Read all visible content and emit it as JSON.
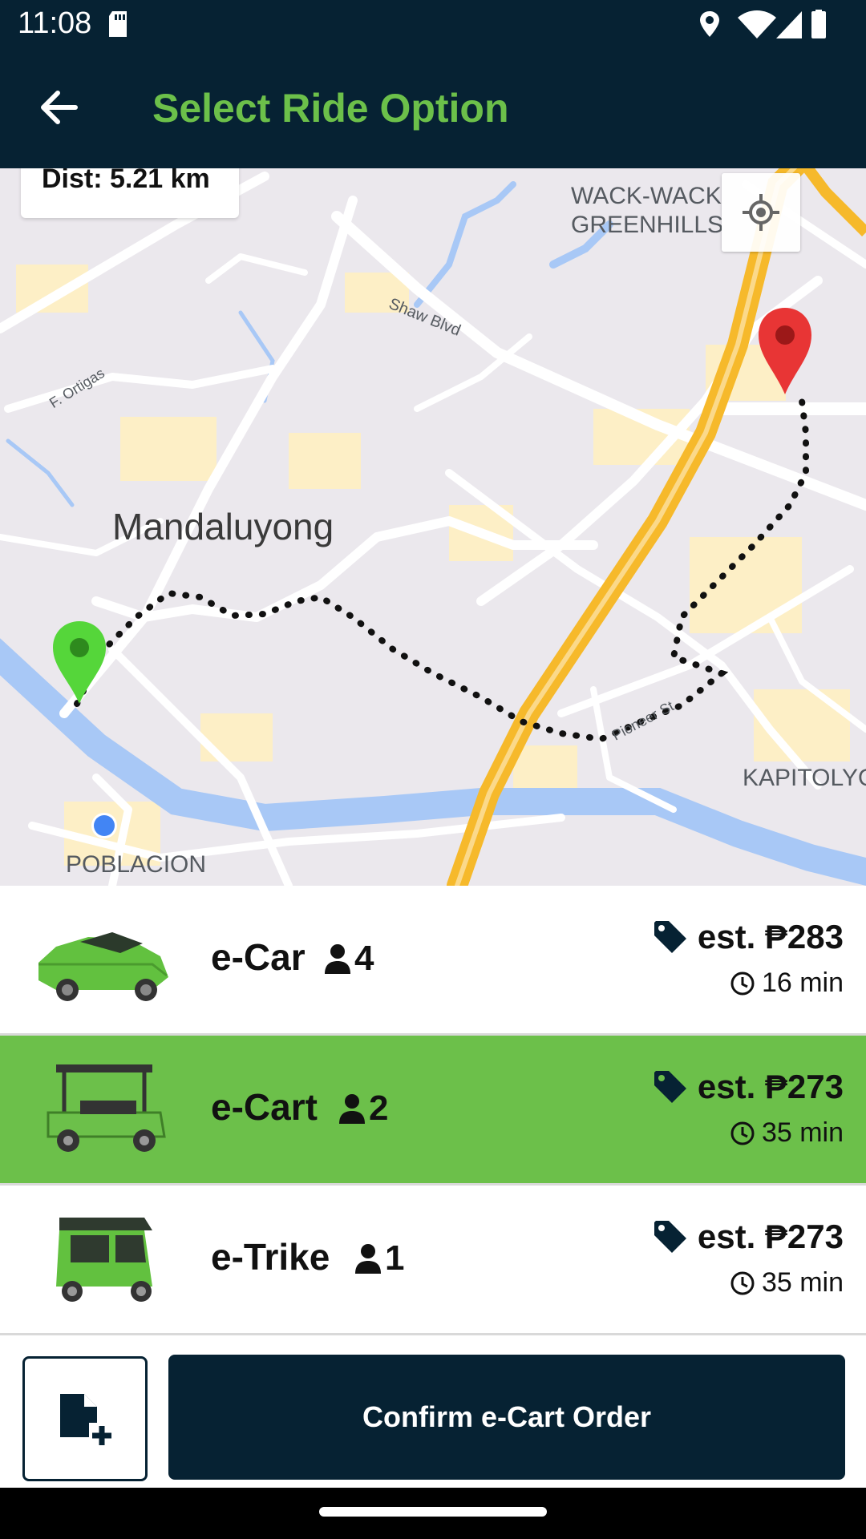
{
  "status_bar": {
    "time": "11:08",
    "icons": [
      "sd-card-icon",
      "location-icon",
      "wifi-icon",
      "signal-icon",
      "battery-icon"
    ]
  },
  "app_bar": {
    "title": "Select Ride Option",
    "back_icon": "arrow-left-icon"
  },
  "map": {
    "distance_label": "Dist: 5.21 km",
    "labels": {
      "mandaluyong": "Mandaluyong",
      "wack_line1": "WACK-WACK",
      "wack_line2": "GREENHILLS",
      "kapitolyo": "KAPITOLYO",
      "poblacion": "POBLACION",
      "shaw": "Shaw Blvd",
      "ortigas": "F. Ortigas",
      "pioneer": "Pioneer St"
    },
    "locate_icon": "my-location-icon",
    "pickup_marker": "green-pin-icon",
    "dropoff_marker": "red-pin-icon"
  },
  "rides": [
    {
      "name": "e-Car",
      "capacity": "4",
      "price": "est. ₱283",
      "eta": "16 min",
      "selected": false,
      "vehicle_icon": "car-icon"
    },
    {
      "name": "e-Cart",
      "capacity": "2",
      "price": "est. ₱273",
      "eta": "35 min",
      "selected": true,
      "vehicle_icon": "golf-cart-icon"
    },
    {
      "name": "e-Trike",
      "capacity": "1",
      "price": "est. ₱273",
      "eta": "35 min",
      "selected": false,
      "vehicle_icon": "tricycle-icon"
    }
  ],
  "bottom": {
    "note_icon": "add-note-icon",
    "confirm_label": "Confirm e-Cart Order"
  },
  "colors": {
    "dark": "#062233",
    "accent_green": "#6cc04a",
    "map_bg": "#ebe8ed",
    "water": "#a8c8f6",
    "highway": "#f6b92b"
  }
}
